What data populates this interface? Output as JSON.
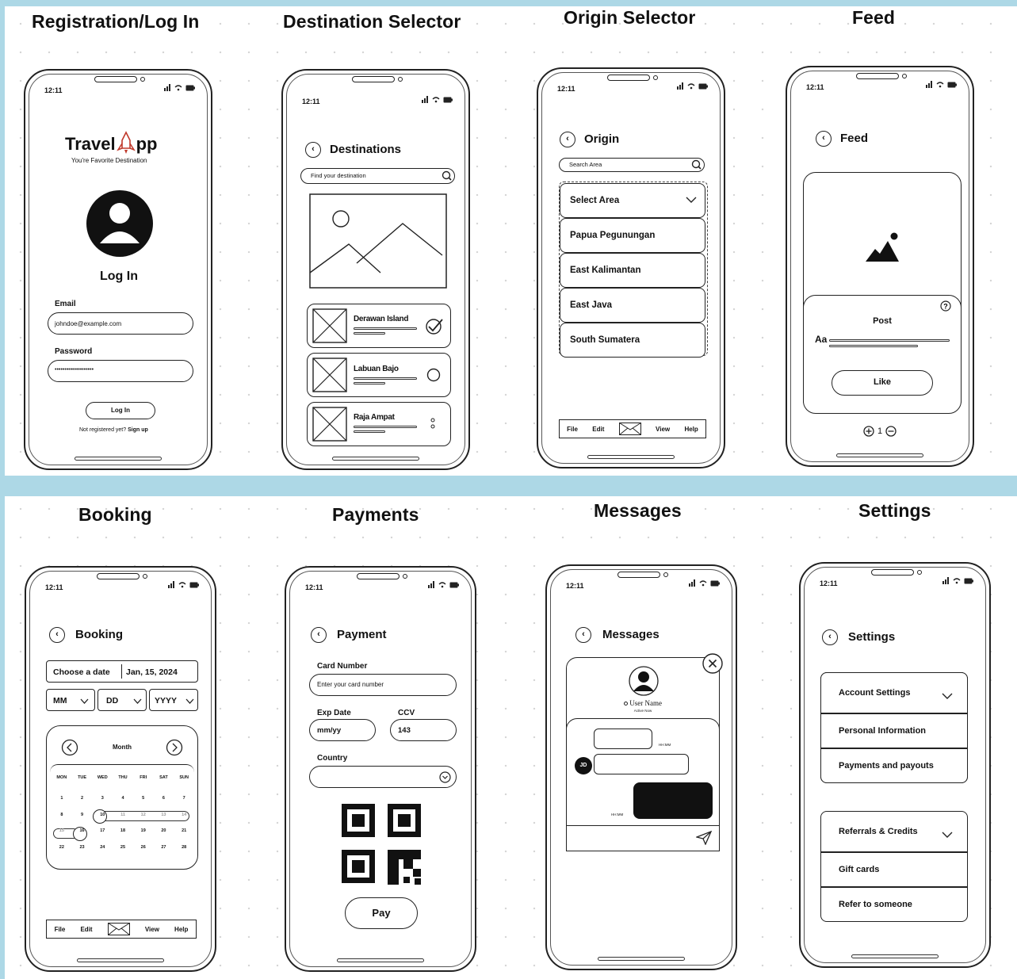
{
  "frames": {
    "registration": {
      "title": "Registration/Log In",
      "time": "12:11",
      "brand_left": "Travel",
      "brand_right": "pp",
      "tagline": "You're Favorite Destination",
      "heading": "Log In",
      "email_label": "Email",
      "email_value": "johndoe@example.com",
      "password_label": "Password",
      "password_value": "••••••••••••••••••••",
      "login_button": "Log In",
      "signup_text": "Not registered yet?",
      "signup_link": "Sign up"
    },
    "destination": {
      "title": "Destination Selector",
      "time": "12:11",
      "heading": "Destinations",
      "search_placeholder": "Find your destination",
      "items": [
        "Derawan Island",
        "Labuan Bajo",
        "Raja Ampat"
      ]
    },
    "origin": {
      "title": "Origin Selector",
      "time": "12:11",
      "heading": "Origin",
      "search_placeholder": "Search Area",
      "select_label": "Select Area",
      "options": [
        "Papua Pegunungan",
        "East Kalimantan",
        "East Java",
        "South Sumatera"
      ],
      "nav": {
        "file": "File",
        "edit": "Edit",
        "view": "View",
        "help": "Help"
      }
    },
    "feed": {
      "title": "Feed",
      "time": "12:11",
      "heading": "Feed",
      "post_label": "Post",
      "text_glyph": "Aa",
      "like_button": "Like",
      "counter": "1"
    },
    "booking": {
      "title": "Booking",
      "time": "12:11",
      "heading": "Booking",
      "choose_label": "Choose a date",
      "date_value": "Jan, 15, 2024",
      "mm": "MM",
      "dd": "DD",
      "yyyy": "YYYY",
      "month_label": "Month",
      "weekdays": [
        "MON",
        "TUE",
        "WED",
        "THU",
        "FRI",
        "SAT",
        "SUN"
      ],
      "weeks": [
        [
          "1",
          "2",
          "3",
          "4",
          "5",
          "6",
          "7"
        ],
        [
          "8",
          "9",
          "10",
          "11",
          "12",
          "13",
          "14"
        ],
        [
          "15",
          "16",
          "17",
          "18",
          "19",
          "20",
          "21"
        ],
        [
          "22",
          "23",
          "24",
          "25",
          "26",
          "27",
          "28"
        ]
      ],
      "nav": {
        "file": "File",
        "edit": "Edit",
        "view": "View",
        "help": "Help"
      }
    },
    "payments": {
      "title": "Payments",
      "time": "12:11",
      "heading": "Payment",
      "card_label": "Card Number",
      "card_placeholder": "Enter your card number",
      "exp_label": "Exp Date",
      "exp_value": "mm/yy",
      "ccv_label": "CCV",
      "ccv_value": "143",
      "country_label": "Country",
      "pay_button": "Pay"
    },
    "messages": {
      "title": "Messages",
      "time": "12:11",
      "heading": "Messages",
      "user_name": "User Name",
      "user_status": "Active Now",
      "avatar_initials": "JD",
      "msg_time": "HH:MM"
    },
    "settings": {
      "title": "Settings",
      "time": "12:11",
      "heading": "Settings",
      "group1": [
        "Account Settings",
        "Personal Information",
        "Payments and payouts"
      ],
      "group2": [
        "Referrals & Credits",
        "Gift cards",
        "Refer to someone"
      ]
    }
  }
}
